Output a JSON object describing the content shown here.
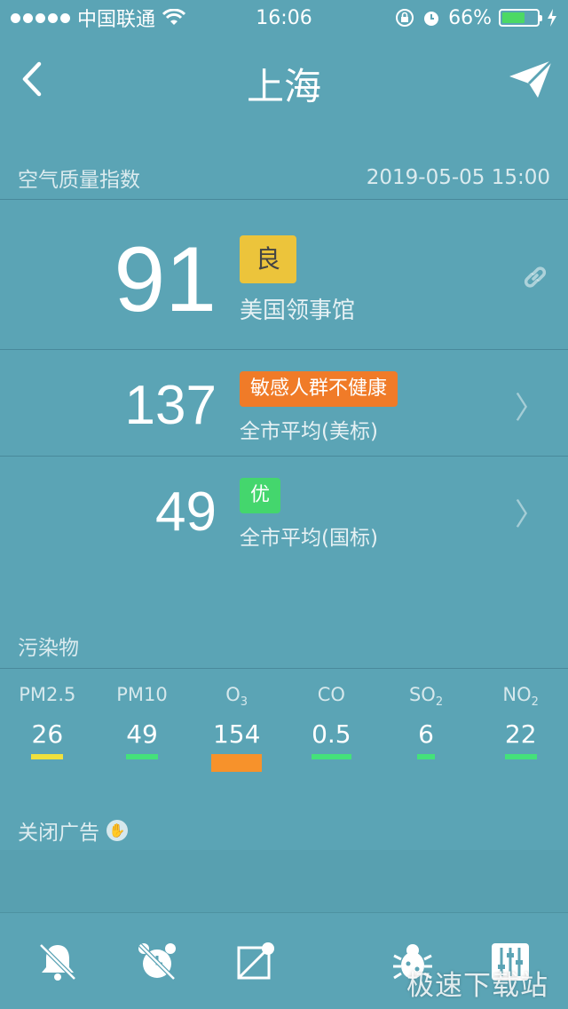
{
  "status": {
    "carrier": "中国联通",
    "time": "16:06",
    "battery": "66%",
    "battery_level": 0.66
  },
  "nav": {
    "title": "上海"
  },
  "aqi": {
    "header": "空气质量指数",
    "timestamp": "2019-05-05 15:00",
    "rows": [
      {
        "value": "91",
        "badge": "良",
        "badge_color": "#ecc43b",
        "label": "美国领事馆"
      },
      {
        "value": "137",
        "badge": "敏感人群不健康",
        "badge_color": "#f07b28",
        "label": "全市平均(美标)"
      },
      {
        "value": "49",
        "badge": "优",
        "badge_color": "#44d66d",
        "label": "全市平均(国标)"
      }
    ]
  },
  "pollutants": {
    "header": "污染物",
    "items": [
      {
        "name": "PM2.5",
        "sub": "",
        "value": "26",
        "color": "#f0e13d"
      },
      {
        "name": "PM10",
        "sub": "",
        "value": "49",
        "color": "#44e27a"
      },
      {
        "name": "O",
        "sub": "3",
        "value": "154",
        "color": "#f7922b"
      },
      {
        "name": "CO",
        "sub": "",
        "value": "0.5",
        "color": "#44e27a"
      },
      {
        "name": "SO",
        "sub": "2",
        "value": "6",
        "color": "#44e27a"
      },
      {
        "name": "NO",
        "sub": "2",
        "value": "22",
        "color": "#44e27a"
      }
    ]
  },
  "ad": {
    "close_label": "关闭广告"
  },
  "tabs": [
    {
      "icon": "bell-off-icon"
    },
    {
      "icon": "alarm-off-icon"
    },
    {
      "icon": "card-off-icon"
    },
    {
      "icon": "bug-icon"
    },
    {
      "icon": "sliders-icon"
    }
  ],
  "watermark": "极速下载站"
}
